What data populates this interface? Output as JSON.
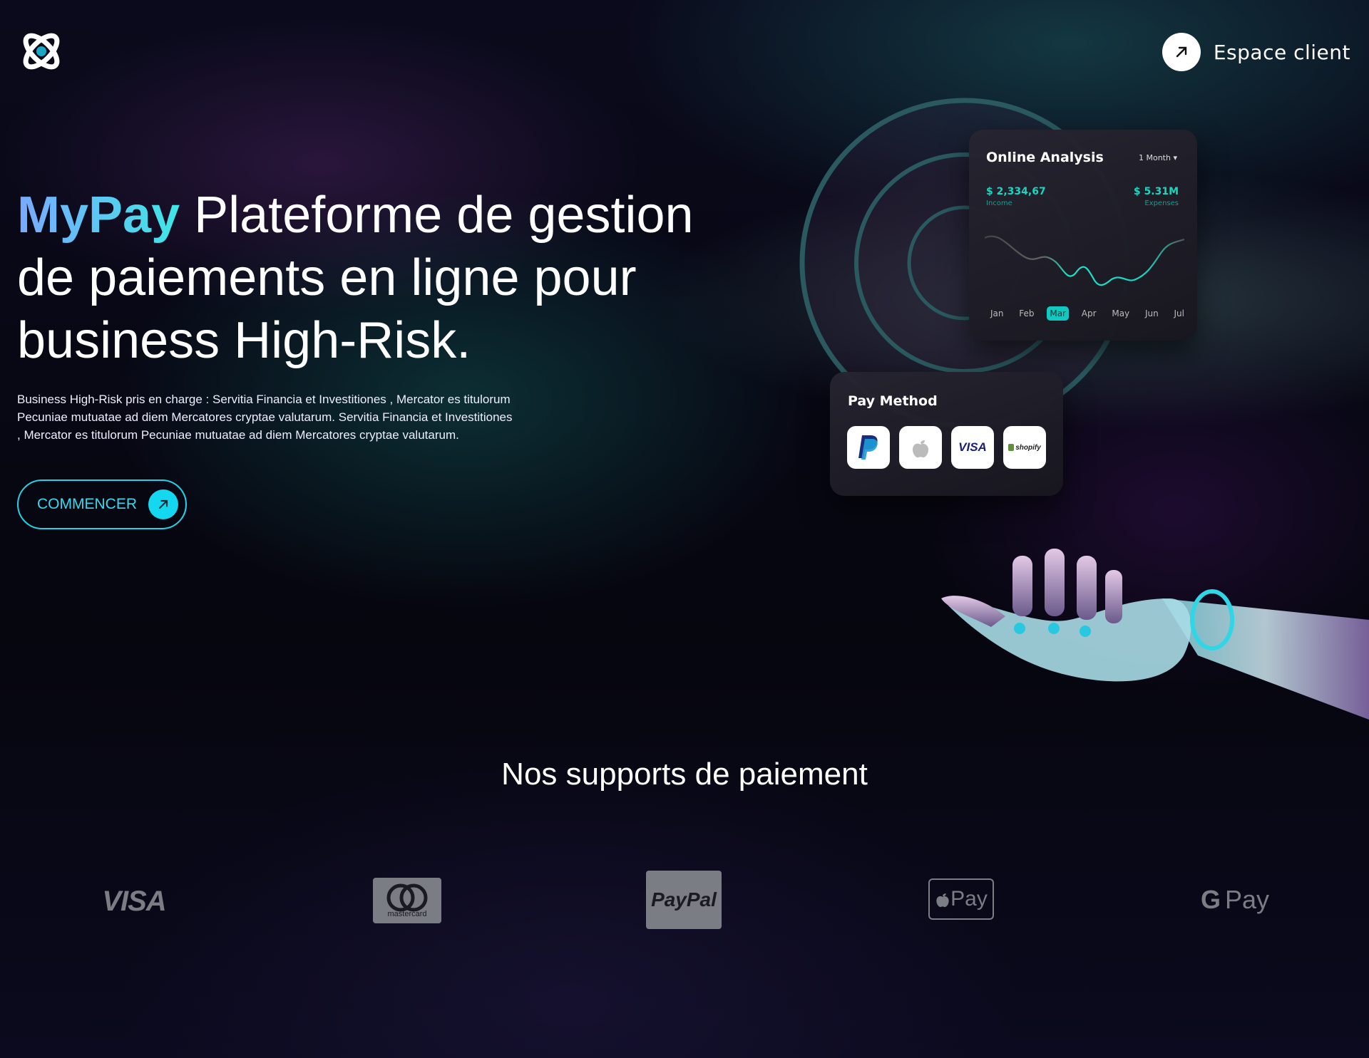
{
  "header": {
    "client_label": "Espace client",
    "logo_icon": "atom-logo-icon",
    "client_icon": "arrow-up-right-icon"
  },
  "hero": {
    "brand": "MyPay",
    "title_rest": " Plateforme de gestion de paiements en ligne pour business High-Risk.",
    "description": "Business High-Risk pris en charge : Servitia Financia et Investitiones , Mercator es titulorum Pecuniae mutuatae ad diem Mercatores cryptae valutarum. Servitia Financia et Investitiones , Mercator es titulorum Pecuniae mutuatae ad diem Mercatores cryptae valutarum.",
    "cta_label": "COMMENCER"
  },
  "analysis_card": {
    "title": "Online Analysis",
    "period": "1 Month",
    "income_value": "$ 2,334,67",
    "income_label": "Income",
    "expenses_value": "$ 5.31M",
    "expenses_label": "Expenses",
    "months": [
      "Jan",
      "Feb",
      "Mar",
      "Apr",
      "May",
      "Jun",
      "Jul"
    ],
    "active_month": "Mar",
    "accent": "#19d6c0"
  },
  "pay_method_card": {
    "title": "Pay Method",
    "methods": [
      "PayPal",
      "Apple Pay",
      "VISA",
      "shopify"
    ]
  },
  "supports": {
    "title": "Nos supports de paiement",
    "logos": [
      {
        "name": "visa",
        "text": "VISA"
      },
      {
        "name": "mastercard",
        "text": "mastercard"
      },
      {
        "name": "paypal",
        "text": "PayPal"
      },
      {
        "name": "apple-pay",
        "text": "Pay"
      },
      {
        "name": "google-pay",
        "text": "Pay"
      }
    ],
    "logo_color": "#7b7d85"
  },
  "colors": {
    "brand_gradient_start": "#7aa9ff",
    "brand_gradient_end": "#3ee7e6",
    "cta_border": "#22d3e6",
    "background": "#05050f"
  }
}
